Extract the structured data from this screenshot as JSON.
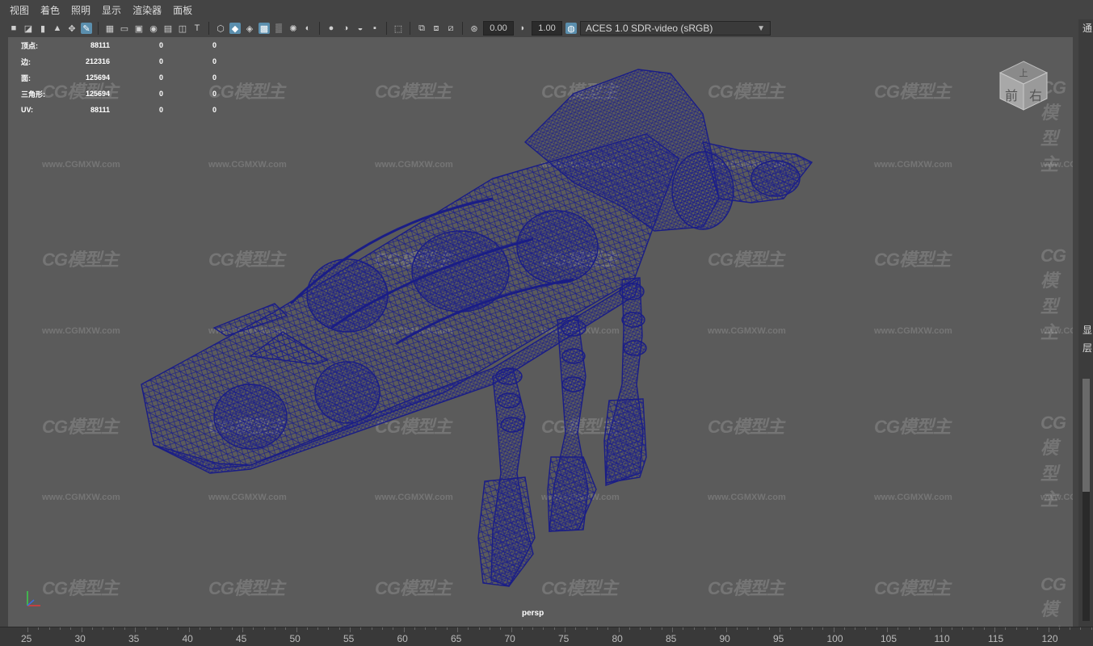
{
  "menu": {
    "items": [
      "视图",
      "着色",
      "照明",
      "显示",
      "渲染器",
      "面板"
    ]
  },
  "toolbar": {
    "exposure_value": "0.00",
    "gamma_value": "1.00",
    "color_space": "ACES 1.0 SDR-video (sRGB)",
    "icons": [
      "camera-select-icon",
      "camera-attributes-icon",
      "bookmark-icon",
      "image-plane-icon",
      "2d-pan-zoom-icon",
      "grease-pencil-icon",
      "grid-icon",
      "film-gate-icon",
      "resolution-gate-icon",
      "gate-mask-icon",
      "field-chart-icon",
      "safe-action-icon",
      "safe-title-icon",
      "wireframe-icon",
      "smooth-shade-icon",
      "wireframe-on-shaded-icon",
      "default-material-icon",
      "xray-icon",
      "textured-icon",
      "use-all-lights-icon",
      "shadows-icon",
      "screen-space-ao-icon",
      "motion-blur-icon",
      "anti-aliasing-icon",
      "depth-of-field-icon",
      "isolate-select-icon",
      "xray-active-icon",
      "xray-joints-icon",
      "backface-cull-icon",
      "exposure-icon",
      "gamma-icon",
      "color-management-icon"
    ],
    "active_icons": [
      "grease-pencil-icon",
      "wireframe-on-shaded-icon",
      "xray-icon"
    ]
  },
  "hud": {
    "rows": [
      {
        "label": "顶点:",
        "value": "88111",
        "sel": "0",
        "comp": "0"
      },
      {
        "label": "边:",
        "value": "212316",
        "sel": "0",
        "comp": "0"
      },
      {
        "label": "面:",
        "value": "125694",
        "sel": "0",
        "comp": "0"
      },
      {
        "label": "三角形:",
        "value": "125694",
        "sel": "0",
        "comp": "0"
      },
      {
        "label": "UV:",
        "value": "88111",
        "sel": "0",
        "comp": "0"
      }
    ]
  },
  "viewport": {
    "camera": "persp",
    "wireframe_color": "#1c1f8a",
    "background": "#5b5b5b"
  },
  "viewcube": {
    "top": "上",
    "front": "前",
    "right": "右"
  },
  "watermark": {
    "logo": "CG模型主",
    "url": "www.CGMXW.com"
  },
  "right_panel": {
    "texts": [
      "通",
      "显",
      "层"
    ]
  },
  "timeline": {
    "ticks": [
      "25",
      "30",
      "35",
      "40",
      "45",
      "50",
      "55",
      "60",
      "65",
      "70",
      "75",
      "80",
      "85",
      "90",
      "95",
      "100",
      "105",
      "110",
      "115",
      "120"
    ]
  }
}
